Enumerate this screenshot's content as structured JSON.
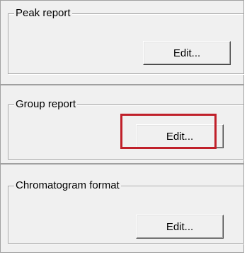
{
  "groups": [
    {
      "title": "Peak report",
      "button_label": "Edit..."
    },
    {
      "title": "Group report",
      "button_label": "Edit..."
    },
    {
      "title": "Chromatogram format",
      "button_label": "Edit..."
    }
  ],
  "highlight_color": "#c0202a"
}
